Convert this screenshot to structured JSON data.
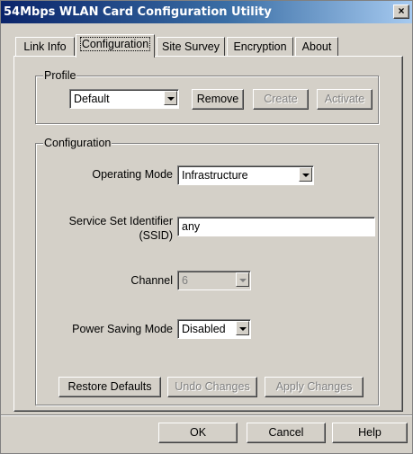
{
  "window": {
    "title": "54Mbps WLAN Card Configuration Utility",
    "close_label": "×"
  },
  "tabs": [
    {
      "label": "Link Info"
    },
    {
      "label": "Configuration"
    },
    {
      "label": "Site Survey"
    },
    {
      "label": "Encryption"
    },
    {
      "label": "About"
    }
  ],
  "profile": {
    "group_label": "Profile",
    "selected": "Default",
    "remove_label": "Remove",
    "create_label": "Create",
    "activate_label": "Activate"
  },
  "configuration": {
    "group_label": "Configuration",
    "operating_mode_label": "Operating Mode",
    "operating_mode_value": "Infrastructure",
    "ssid_label_line1": "Service Set Identifier",
    "ssid_label_line2": "(SSID)",
    "ssid_value": "any",
    "channel_label": "Channel",
    "channel_value": "6",
    "power_saving_label": "Power Saving Mode",
    "power_saving_value": "Disabled",
    "restore_defaults_label": "Restore Defaults",
    "undo_changes_label": "Undo Changes",
    "apply_changes_label": "Apply Changes"
  },
  "footer": {
    "ok_label": "OK",
    "cancel_label": "Cancel",
    "help_label": "Help"
  }
}
